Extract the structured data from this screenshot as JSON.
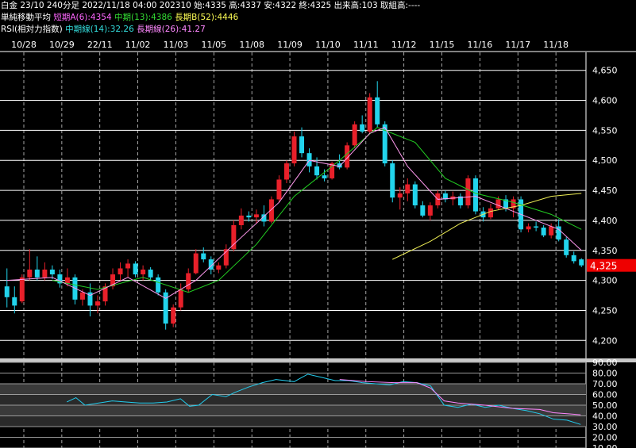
{
  "header": {
    "line1": "白金 23/10 240分足 2022/11/18 04:00 202310 始:4335 高:4337 安:4322 終:4325 出来高:103 取組高:----",
    "line2_prefix": "単純移動平均",
    "ma_short": "短期A(6):4354",
    "ma_mid": "中期(13):4386",
    "ma_long": "長期B(52):4446",
    "line3_prefix": "RSI(相対力指数)",
    "rsi_mid": "中期線(14):32.26",
    "rsi_long": "長期線(26):41.27"
  },
  "colors": {
    "up": "#e8202a",
    "down": "#22d4ec",
    "ma6": "#ff99ee",
    "ma13": "#22cc22",
    "ma52": "#eeee55",
    "rsi14": "#22ccee",
    "rsi26": "#ff88ff",
    "price_label_bg": "#ee0000"
  },
  "chart_data": [
    {
      "type": "candlestick",
      "dates": [
        "10/28",
        "10/29",
        "22/11",
        "11/02",
        "11/03",
        "11/05",
        "11/08",
        "11/09",
        "11/10",
        "11/11",
        "11/12",
        "11/15",
        "11/16",
        "11/17",
        "11/18"
      ],
      "ylim": [
        4170,
        4680
      ],
      "yticks": [
        4200,
        4250,
        4300,
        4350,
        4400,
        4450,
        4500,
        4550,
        4600,
        4650
      ],
      "last_price_label": "4,325",
      "last_price": 4325,
      "candles": [
        [
          4290,
          4320,
          4255,
          4272
        ],
        [
          4272,
          4290,
          4245,
          4258
        ],
        [
          4265,
          4310,
          4262,
          4305
        ],
        [
          4305,
          4352,
          4300,
          4318
        ],
        [
          4318,
          4340,
          4300,
          4305
        ],
        [
          4305,
          4330,
          4300,
          4318
        ],
        [
          4318,
          4325,
          4302,
          4310
        ],
        [
          4310,
          4318,
          4288,
          4295
        ],
        [
          4295,
          4320,
          4290,
          4305
        ],
        [
          4305,
          4310,
          4260,
          4268
        ],
        [
          4268,
          4285,
          4258,
          4280
        ],
        [
          4280,
          4295,
          4240,
          4258
        ],
        [
          4258,
          4275,
          4245,
          4265
        ],
        [
          4265,
          4295,
          4258,
          4290
        ],
        [
          4290,
          4320,
          4285,
          4310
        ],
        [
          4310,
          4330,
          4300,
          4320
        ],
        [
          4320,
          4335,
          4305,
          4328
        ],
        [
          4328,
          4332,
          4305,
          4310
        ],
        [
          4310,
          4325,
          4300,
          4318
        ],
        [
          4318,
          4322,
          4300,
          4305
        ],
        [
          4305,
          4310,
          4275,
          4280
        ],
        [
          4280,
          4285,
          4218,
          4228
        ],
        [
          4228,
          4260,
          4222,
          4255
        ],
        [
          4255,
          4295,
          4250,
          4285
        ],
        [
          4285,
          4320,
          4280,
          4312
        ],
        [
          4312,
          4352,
          4310,
          4345
        ],
        [
          4345,
          4355,
          4330,
          4335
        ],
        [
          4335,
          4340,
          4310,
          4318
        ],
        [
          4318,
          4330,
          4312,
          4325
        ],
        [
          4325,
          4360,
          4320,
          4352
        ],
        [
          4352,
          4400,
          4348,
          4392
        ],
        [
          4392,
          4420,
          4385,
          4408
        ],
        [
          4408,
          4415,
          4398,
          4405
        ],
        [
          4405,
          4418,
          4395,
          4410
        ],
        [
          4410,
          4425,
          4390,
          4398
        ],
        [
          4398,
          4440,
          4395,
          4435
        ],
        [
          4435,
          4475,
          4430,
          4468
        ],
        [
          4468,
          4500,
          4462,
          4495
        ],
        [
          4495,
          4548,
          4490,
          4540
        ],
        [
          4540,
          4555,
          4505,
          4512
        ],
        [
          4512,
          4520,
          4480,
          4490
        ],
        [
          4490,
          4505,
          4468,
          4475
        ],
        [
          4475,
          4485,
          4465,
          4470
        ],
        [
          4470,
          4498,
          4468,
          4495
        ],
        [
          4495,
          4510,
          4485,
          4488
        ],
        [
          4488,
          4530,
          4485,
          4525
        ],
        [
          4525,
          4565,
          4520,
          4560
        ],
        [
          4560,
          4575,
          4545,
          4548
        ],
        [
          4548,
          4612,
          4545,
          4605
        ],
        [
          4605,
          4632,
          4555,
          4560
        ],
        [
          4560,
          4565,
          4490,
          4495
        ],
        [
          4495,
          4500,
          4430,
          4438
        ],
        [
          4438,
          4455,
          4418,
          4445
        ],
        [
          4445,
          4470,
          4432,
          4460
        ],
        [
          4460,
          4465,
          4420,
          4425
        ],
        [
          4425,
          4432,
          4405,
          4408
        ],
        [
          4408,
          4430,
          4400,
          4425
        ],
        [
          4425,
          4450,
          4420,
          4445
        ],
        [
          4445,
          4450,
          4430,
          4435
        ],
        [
          4435,
          4448,
          4425,
          4440
        ],
        [
          4440,
          4445,
          4420,
          4425
        ],
        [
          4425,
          4475,
          4420,
          4470
        ],
        [
          4470,
          4475,
          4410,
          4415
        ],
        [
          4415,
          4422,
          4398,
          4405
        ],
        [
          4405,
          4428,
          4402,
          4420
        ],
        [
          4420,
          4440,
          4418,
          4435
        ],
        [
          4435,
          4442,
          4415,
          4420
        ],
        [
          4420,
          4440,
          4405,
          4435
        ],
        [
          4435,
          4440,
          4380,
          4385
        ],
        [
          4385,
          4395,
          4380,
          4390
        ],
        [
          4390,
          4398,
          4382,
          4388
        ],
        [
          4388,
          4392,
          4372,
          4375
        ],
        [
          4375,
          4395,
          4370,
          4390
        ],
        [
          4390,
          4402,
          4365,
          4368
        ],
        [
          4368,
          4372,
          4338,
          4342
        ],
        [
          4342,
          4348,
          4328,
          4332
        ],
        [
          4335,
          4337,
          4322,
          4325
        ]
      ],
      "ma6": [
        [
          0,
          4300
        ],
        [
          6,
          4305
        ],
        [
          11,
          4275
        ],
        [
          16,
          4305
        ],
        [
          21,
          4270
        ],
        [
          25,
          4300
        ],
        [
          30,
          4360
        ],
        [
          36,
          4430
        ],
        [
          40,
          4500
        ],
        [
          44,
          4490
        ],
        [
          48,
          4545
        ],
        [
          50,
          4555
        ],
        [
          53,
          4490
        ],
        [
          57,
          4435
        ],
        [
          62,
          4440
        ],
        [
          66,
          4420
        ],
        [
          70,
          4400
        ],
        [
          73,
          4385
        ],
        [
          76,
          4350
        ]
      ],
      "ma13": [
        [
          6,
          4300
        ],
        [
          12,
          4285
        ],
        [
          18,
          4305
        ],
        [
          24,
          4280
        ],
        [
          28,
          4300
        ],
        [
          33,
          4360
        ],
        [
          38,
          4440
        ],
        [
          44,
          4500
        ],
        [
          49,
          4555
        ],
        [
          54,
          4530
        ],
        [
          58,
          4470
        ],
        [
          62,
          4445
        ],
        [
          67,
          4430
        ],
        [
          72,
          4410
        ],
        [
          76,
          4385
        ]
      ],
      "ma52": [
        [
          51,
          4335
        ],
        [
          56,
          4365
        ],
        [
          60,
          4395
        ],
        [
          64,
          4415
        ],
        [
          68,
          4425
        ],
        [
          72,
          4440
        ],
        [
          76,
          4445
        ]
      ]
    },
    {
      "type": "line",
      "ylim": [
        10,
        90
      ],
      "yticks": [
        10,
        20,
        30,
        40,
        50,
        60,
        70,
        80,
        90
      ],
      "tick_labels": [
        "10.00",
        "20.00",
        "30.00",
        "40.00",
        "50.00",
        "60.00",
        "70.00",
        "80.00",
        "90.00"
      ],
      "series": [
        {
          "name": "中期線(14)",
          "values": [
            [
              14,
              53
            ],
            [
              16,
              57
            ],
            [
              18,
              50
            ],
            [
              21,
              52
            ],
            [
              24,
              54
            ],
            [
              27,
              53
            ],
            [
              30,
              52
            ],
            [
              33,
              52
            ],
            [
              36,
              53
            ],
            [
              39,
              56
            ],
            [
              41,
              49
            ],
            [
              43,
              50
            ],
            [
              46,
              60
            ],
            [
              49,
              58
            ],
            [
              51,
              62
            ],
            [
              54,
              67
            ],
            [
              57,
              71
            ],
            [
              60,
              74
            ],
            [
              64,
              72
            ],
            [
              67,
              79
            ],
            [
              70,
              76
            ],
            [
              73,
              73
            ],
            [
              76,
              73
            ],
            [
              79,
              71
            ],
            [
              82,
              70
            ],
            [
              85,
              69
            ],
            [
              88,
              72
            ],
            [
              91,
              71
            ],
            [
              94,
              68
            ],
            [
              97,
              50
            ],
            [
              100,
              48
            ],
            [
              103,
              51
            ],
            [
              106,
              48
            ],
            [
              109,
              50
            ],
            [
              112,
              47
            ],
            [
              115,
              45
            ],
            [
              118,
              42
            ],
            [
              121,
              37
            ],
            [
              124,
              36
            ],
            [
              127,
              32
            ]
          ]
        },
        {
          "name": "長期線(26)",
          "values": [
            [
              74,
              74
            ],
            [
              80,
              72
            ],
            [
              86,
              71
            ],
            [
              91,
              71
            ],
            [
              94,
              66
            ],
            [
              97,
              54
            ],
            [
              100,
              52
            ],
            [
              106,
              50
            ],
            [
              112,
              47
            ],
            [
              118,
              46
            ],
            [
              121,
              43
            ],
            [
              124,
              42
            ],
            [
              127,
              41
            ]
          ]
        }
      ]
    }
  ]
}
